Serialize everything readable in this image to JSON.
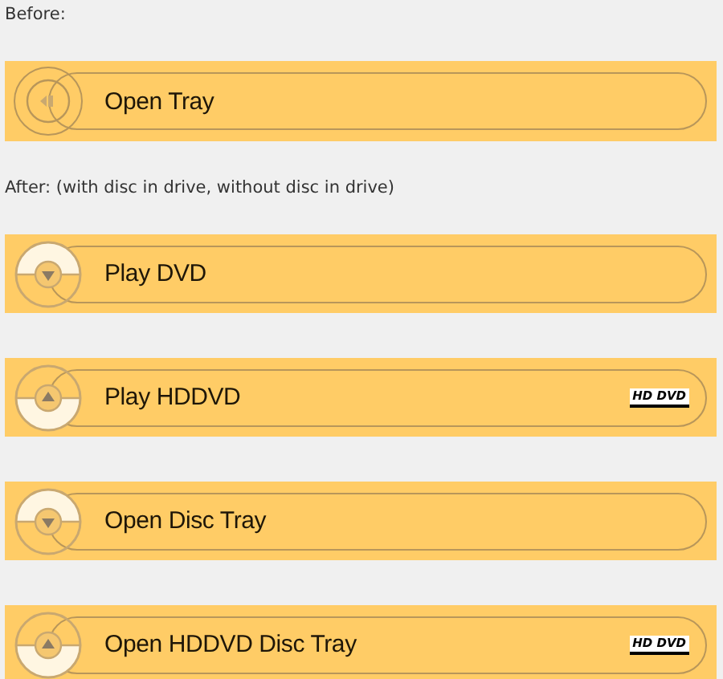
{
  "sections": [
    {
      "heading": "Before:",
      "buttons": [
        {
          "label": "Open Tray",
          "kind": "tray"
        }
      ]
    },
    {
      "heading": "After: (with disc in drive, without disc in drive)",
      "buttons": [
        {
          "label": "Play DVD",
          "kind": "down"
        },
        {
          "label": "Play HDDVD",
          "kind": "up",
          "badge": "HD DVD"
        },
        {
          "label": "Open Disc Tray",
          "kind": "down"
        },
        {
          "label": "Open HDDVD Disc Tray",
          "kind": "up",
          "badge": "HD DVD"
        }
      ]
    }
  ]
}
